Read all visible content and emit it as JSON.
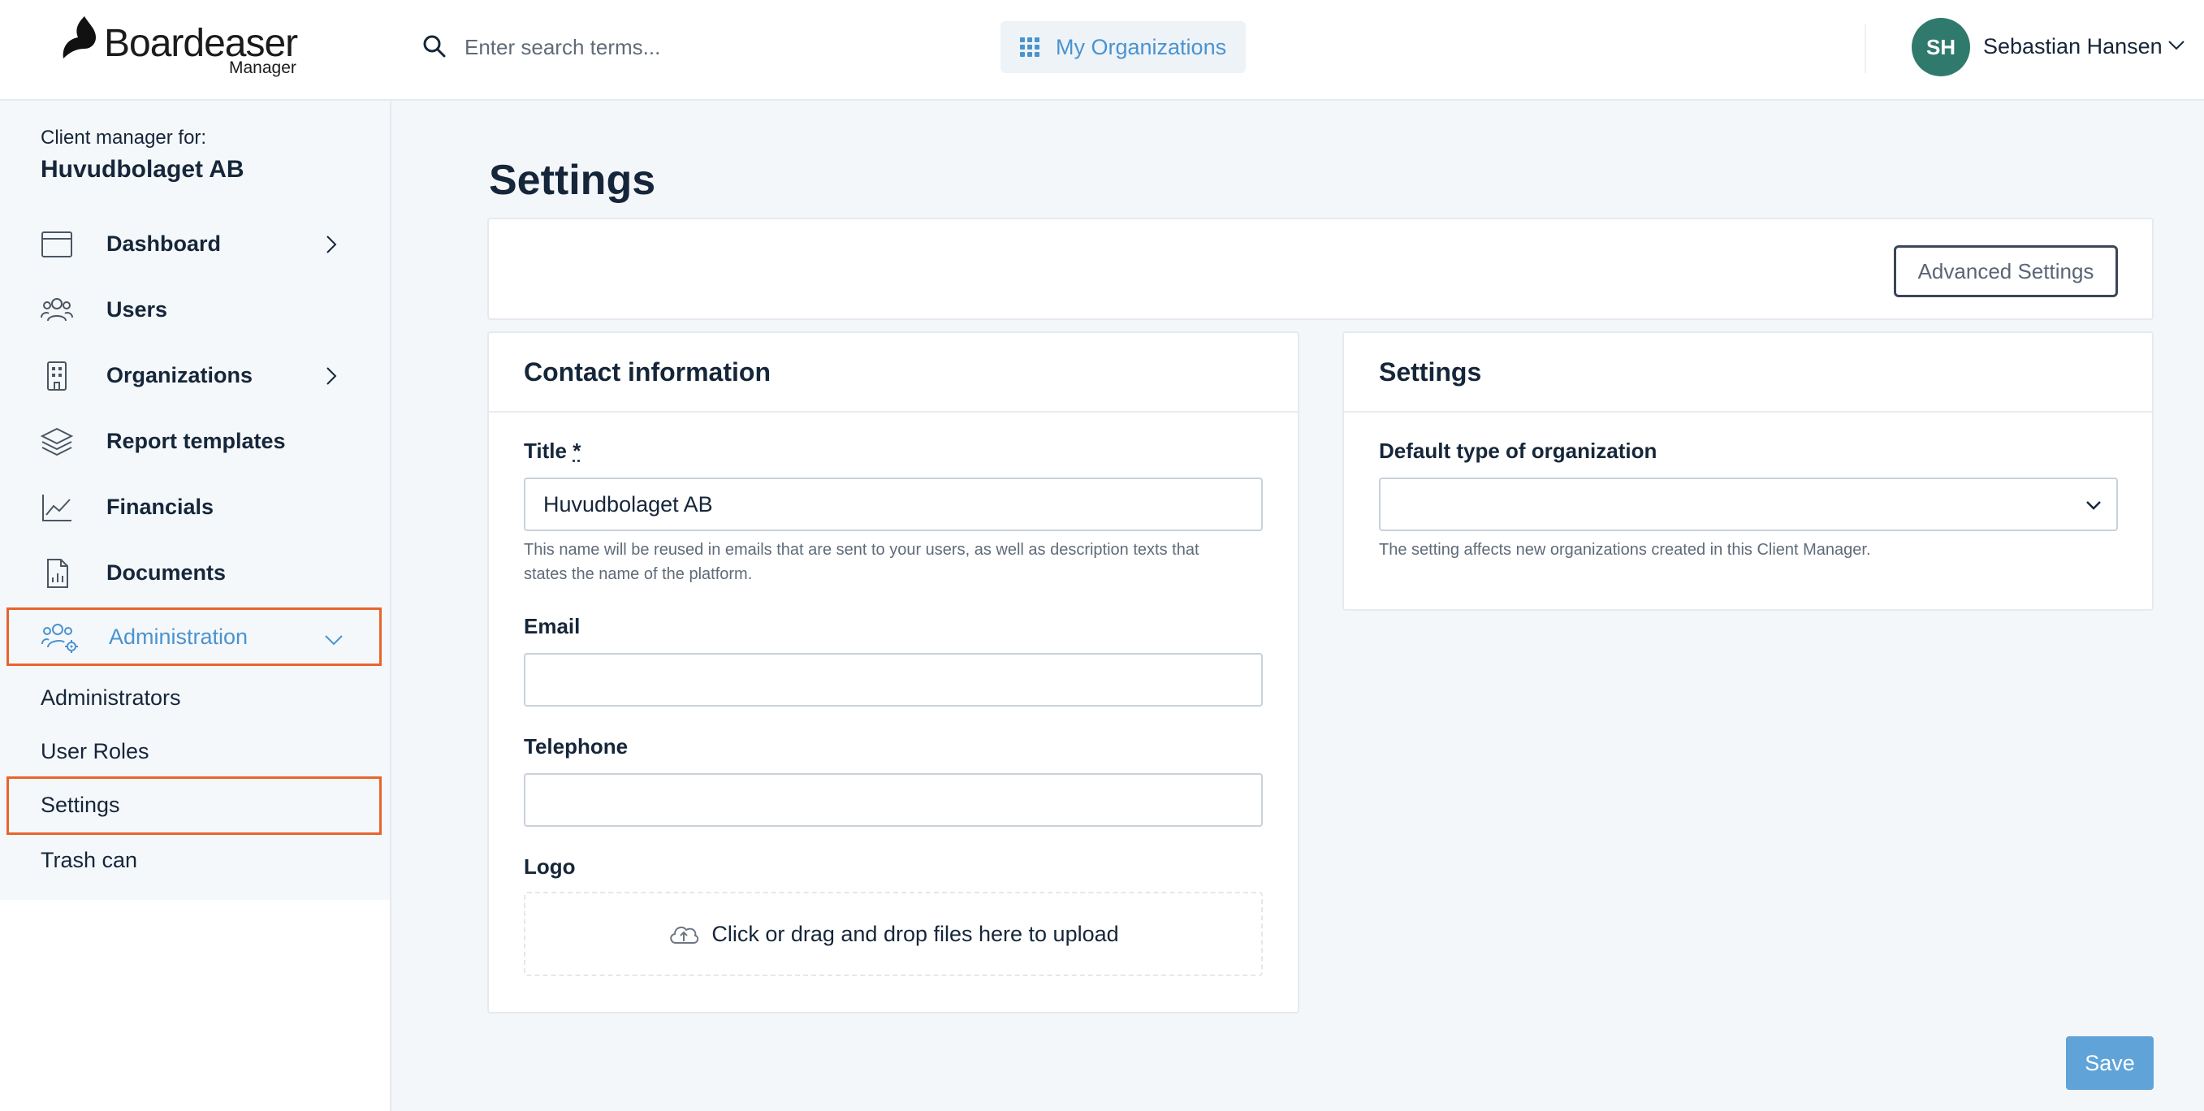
{
  "header": {
    "brand": "Boardeaser",
    "brand_sub": "Manager",
    "search_placeholder": "Enter search terms...",
    "my_organizations": "My Organizations",
    "user_initials": "SH",
    "user_name": "Sebastian Hansen"
  },
  "sidebar": {
    "client_manager_label": "Client manager for:",
    "client_name": "Huvudbolaget AB",
    "items": [
      {
        "label": "Dashboard",
        "icon": "dashboard-icon",
        "has_chevron": true
      },
      {
        "label": "Users",
        "icon": "users-icon"
      },
      {
        "label": "Organizations",
        "icon": "building-icon",
        "has_chevron": true
      },
      {
        "label": "Report templates",
        "icon": "layers-icon"
      },
      {
        "label": "Financials",
        "icon": "chart-line-icon"
      },
      {
        "label": "Documents",
        "icon": "document-icon"
      },
      {
        "label": "Administration",
        "icon": "admin-users-gear-icon",
        "expanded": true
      }
    ],
    "subitems": [
      {
        "label": "Administrators"
      },
      {
        "label": "User Roles"
      },
      {
        "label": "Settings",
        "active": true
      },
      {
        "label": "Trash can"
      }
    ]
  },
  "main": {
    "page_title": "Settings",
    "advanced_settings_button": "Advanced Settings",
    "contact": {
      "title": "Contact information",
      "title_label": "Title",
      "required_mark": "*",
      "title_value": "Huvudbolaget AB",
      "title_help_line1": "This name will be reused in emails that are sent to your users, as well as description texts that",
      "title_help_line2": "states the name of the platform.",
      "email_label": "Email",
      "email_value": "",
      "telephone_label": "Telephone",
      "telephone_value": "",
      "logo_label": "Logo",
      "upload_text": "Click or drag and drop files here to upload"
    },
    "settings": {
      "title": "Settings",
      "default_type_label": "Default type of organization",
      "default_type_value": "",
      "default_type_help": "The setting affects new organizations created in this Client Manager."
    },
    "save_button": "Save"
  },
  "colors": {
    "accent": "#4a93cf",
    "highlight": "#e8642c",
    "avatar": "#2f7a6d",
    "save": "#5fa3d8"
  }
}
